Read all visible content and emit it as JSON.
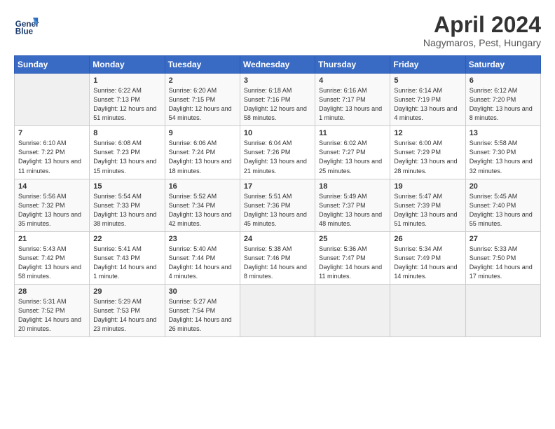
{
  "header": {
    "logo_line1": "General",
    "logo_line2": "Blue",
    "month_title": "April 2024",
    "subtitle": "Nagymaros, Pest, Hungary"
  },
  "weekdays": [
    "Sunday",
    "Monday",
    "Tuesday",
    "Wednesday",
    "Thursday",
    "Friday",
    "Saturday"
  ],
  "weeks": [
    [
      {
        "day": "",
        "sunrise": "",
        "sunset": "",
        "daylight": ""
      },
      {
        "day": "1",
        "sunrise": "6:22 AM",
        "sunset": "7:13 PM",
        "daylight": "12 hours and 51 minutes."
      },
      {
        "day": "2",
        "sunrise": "6:20 AM",
        "sunset": "7:15 PM",
        "daylight": "12 hours and 54 minutes."
      },
      {
        "day": "3",
        "sunrise": "6:18 AM",
        "sunset": "7:16 PM",
        "daylight": "12 hours and 58 minutes."
      },
      {
        "day": "4",
        "sunrise": "6:16 AM",
        "sunset": "7:17 PM",
        "daylight": "13 hours and 1 minute."
      },
      {
        "day": "5",
        "sunrise": "6:14 AM",
        "sunset": "7:19 PM",
        "daylight": "13 hours and 4 minutes."
      },
      {
        "day": "6",
        "sunrise": "6:12 AM",
        "sunset": "7:20 PM",
        "daylight": "13 hours and 8 minutes."
      }
    ],
    [
      {
        "day": "7",
        "sunrise": "6:10 AM",
        "sunset": "7:22 PM",
        "daylight": "13 hours and 11 minutes."
      },
      {
        "day": "8",
        "sunrise": "6:08 AM",
        "sunset": "7:23 PM",
        "daylight": "13 hours and 15 minutes."
      },
      {
        "day": "9",
        "sunrise": "6:06 AM",
        "sunset": "7:24 PM",
        "daylight": "13 hours and 18 minutes."
      },
      {
        "day": "10",
        "sunrise": "6:04 AM",
        "sunset": "7:26 PM",
        "daylight": "13 hours and 21 minutes."
      },
      {
        "day": "11",
        "sunrise": "6:02 AM",
        "sunset": "7:27 PM",
        "daylight": "13 hours and 25 minutes."
      },
      {
        "day": "12",
        "sunrise": "6:00 AM",
        "sunset": "7:29 PM",
        "daylight": "13 hours and 28 minutes."
      },
      {
        "day": "13",
        "sunrise": "5:58 AM",
        "sunset": "7:30 PM",
        "daylight": "13 hours and 32 minutes."
      }
    ],
    [
      {
        "day": "14",
        "sunrise": "5:56 AM",
        "sunset": "7:32 PM",
        "daylight": "13 hours and 35 minutes."
      },
      {
        "day": "15",
        "sunrise": "5:54 AM",
        "sunset": "7:33 PM",
        "daylight": "13 hours and 38 minutes."
      },
      {
        "day": "16",
        "sunrise": "5:52 AM",
        "sunset": "7:34 PM",
        "daylight": "13 hours and 42 minutes."
      },
      {
        "day": "17",
        "sunrise": "5:51 AM",
        "sunset": "7:36 PM",
        "daylight": "13 hours and 45 minutes."
      },
      {
        "day": "18",
        "sunrise": "5:49 AM",
        "sunset": "7:37 PM",
        "daylight": "13 hours and 48 minutes."
      },
      {
        "day": "19",
        "sunrise": "5:47 AM",
        "sunset": "7:39 PM",
        "daylight": "13 hours and 51 minutes."
      },
      {
        "day": "20",
        "sunrise": "5:45 AM",
        "sunset": "7:40 PM",
        "daylight": "13 hours and 55 minutes."
      }
    ],
    [
      {
        "day": "21",
        "sunrise": "5:43 AM",
        "sunset": "7:42 PM",
        "daylight": "13 hours and 58 minutes."
      },
      {
        "day": "22",
        "sunrise": "5:41 AM",
        "sunset": "7:43 PM",
        "daylight": "14 hours and 1 minute."
      },
      {
        "day": "23",
        "sunrise": "5:40 AM",
        "sunset": "7:44 PM",
        "daylight": "14 hours and 4 minutes."
      },
      {
        "day": "24",
        "sunrise": "5:38 AM",
        "sunset": "7:46 PM",
        "daylight": "14 hours and 8 minutes."
      },
      {
        "day": "25",
        "sunrise": "5:36 AM",
        "sunset": "7:47 PM",
        "daylight": "14 hours and 11 minutes."
      },
      {
        "day": "26",
        "sunrise": "5:34 AM",
        "sunset": "7:49 PM",
        "daylight": "14 hours and 14 minutes."
      },
      {
        "day": "27",
        "sunrise": "5:33 AM",
        "sunset": "7:50 PM",
        "daylight": "14 hours and 17 minutes."
      }
    ],
    [
      {
        "day": "28",
        "sunrise": "5:31 AM",
        "sunset": "7:52 PM",
        "daylight": "14 hours and 20 minutes."
      },
      {
        "day": "29",
        "sunrise": "5:29 AM",
        "sunset": "7:53 PM",
        "daylight": "14 hours and 23 minutes."
      },
      {
        "day": "30",
        "sunrise": "5:27 AM",
        "sunset": "7:54 PM",
        "daylight": "14 hours and 26 minutes."
      },
      {
        "day": "",
        "sunrise": "",
        "sunset": "",
        "daylight": ""
      },
      {
        "day": "",
        "sunrise": "",
        "sunset": "",
        "daylight": ""
      },
      {
        "day": "",
        "sunrise": "",
        "sunset": "",
        "daylight": ""
      },
      {
        "day": "",
        "sunrise": "",
        "sunset": "",
        "daylight": ""
      }
    ]
  ]
}
